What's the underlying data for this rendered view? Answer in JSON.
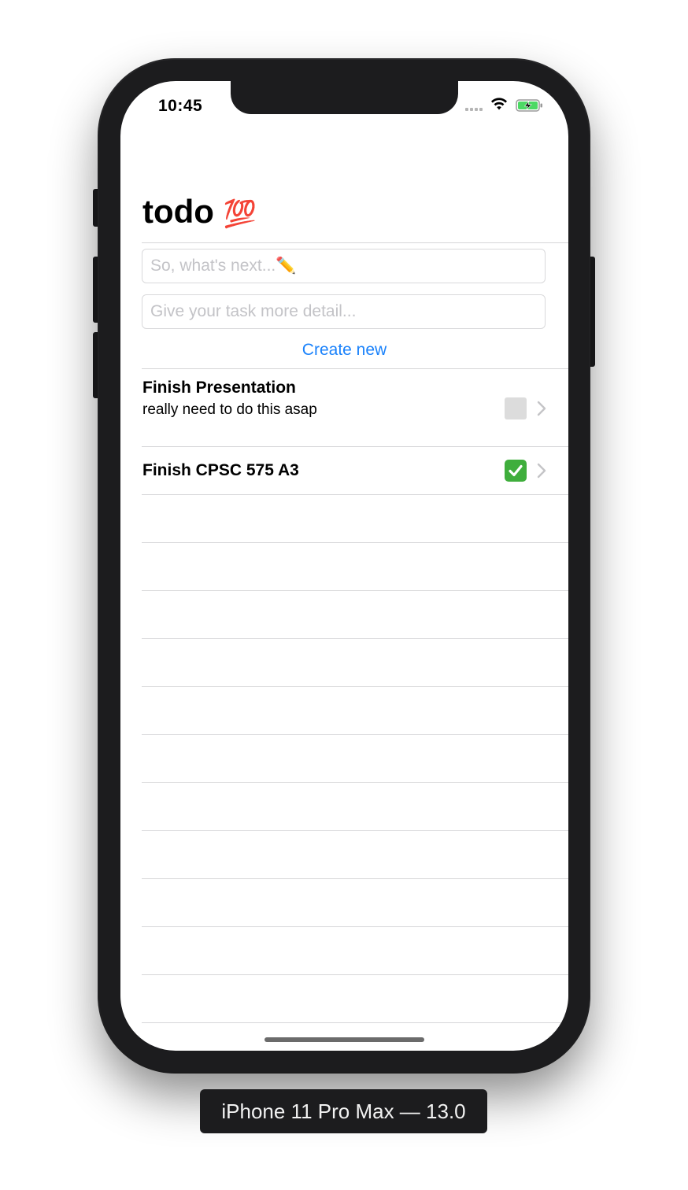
{
  "status_bar": {
    "time": "10:45"
  },
  "nav": {
    "title": "todo",
    "title_emoji": "💯"
  },
  "form": {
    "title_placeholder": "So, what's next...✏️",
    "detail_placeholder": "Give your task more detail...",
    "create_label": "Create new"
  },
  "todos": [
    {
      "title": "Finish Presentation",
      "detail": "really need to do this asap",
      "done": false
    },
    {
      "title": "Finish CPSC 575 A3",
      "detail": "",
      "done": true
    }
  ],
  "device_label": "iPhone 11 Pro Max — 13.0",
  "colors": {
    "accent": "#1a82fb",
    "done": "#3fae3c",
    "pending": "#dcdcdc"
  }
}
